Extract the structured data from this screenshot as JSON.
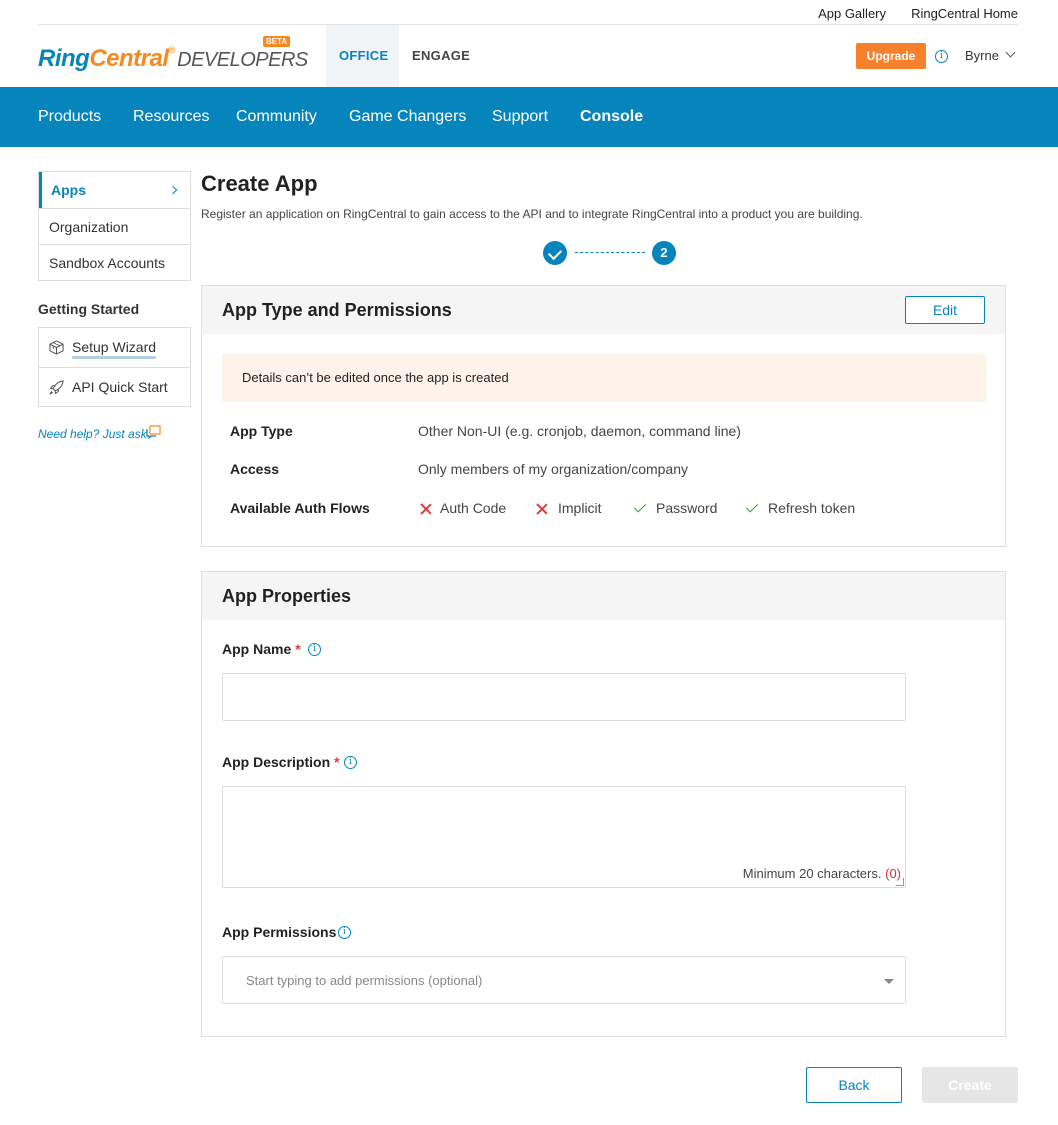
{
  "top_links": {
    "app_gallery": "App Gallery",
    "home": "RingCentral Home"
  },
  "logo": {
    "ring": "Ring",
    "central": "Central",
    "reg": "®",
    "developers": "DEVELOPERS",
    "beta": "BETA"
  },
  "header": {
    "tabs": [
      {
        "label": "OFFICE",
        "active": true
      },
      {
        "label": "ENGAGE",
        "active": false
      }
    ],
    "upgrade": "Upgrade",
    "info_icon": "info-icon",
    "user": "Byrne"
  },
  "main_nav": [
    "Products",
    "Resources",
    "Community",
    "Game Changers",
    "Support",
    "Console"
  ],
  "sidebar": {
    "items": [
      {
        "label": "Apps",
        "active": true
      },
      {
        "label": "Organization"
      },
      {
        "label": "Sandbox Accounts"
      }
    ],
    "getting_started": "Getting Started",
    "gs_items": [
      {
        "label": "Setup Wizard",
        "icon": "cube-icon"
      },
      {
        "label": "API Quick Start",
        "icon": "rocket-icon"
      }
    ],
    "help": "Need help? Just ask"
  },
  "page": {
    "title": "Create App",
    "subtitle": "Register an application on RingCentral to gain access to the API and to integrate RingCentral into a product you are building.",
    "step_current": "2"
  },
  "type_card": {
    "title": "App Type and Permissions",
    "edit": "Edit",
    "notice": "Details can’t be edited once the app is created",
    "rows": [
      {
        "key": "App Type",
        "value": "Other Non-UI (e.g. cronjob, daemon, command line)"
      },
      {
        "key": "Access",
        "value": "Only members of my organization/company"
      },
      {
        "key": "Available Auth Flows"
      }
    ],
    "flows": [
      {
        "label": "Auth Code",
        "enabled": false
      },
      {
        "label": "Implicit",
        "enabled": false
      },
      {
        "label": "Password",
        "enabled": true
      },
      {
        "label": "Refresh token",
        "enabled": true
      }
    ]
  },
  "props_card": {
    "title": "App Properties",
    "name_label": "App Name",
    "name_value": "",
    "desc_label": "App Description",
    "desc_value": "",
    "desc_hint": "Minimum 20 characters.",
    "desc_count": "(0)",
    "perm_label": "App Permissions",
    "perm_placeholder": "Start typing to add permissions (optional)",
    "required_mark": "*"
  },
  "footer": {
    "back": "Back",
    "create": "Create"
  },
  "colors": {
    "brand_blue": "#0684bc",
    "brand_orange": "#f7891e",
    "upgrade": "#f7802d",
    "error": "#e53935",
    "success": "#2e9e3a"
  }
}
